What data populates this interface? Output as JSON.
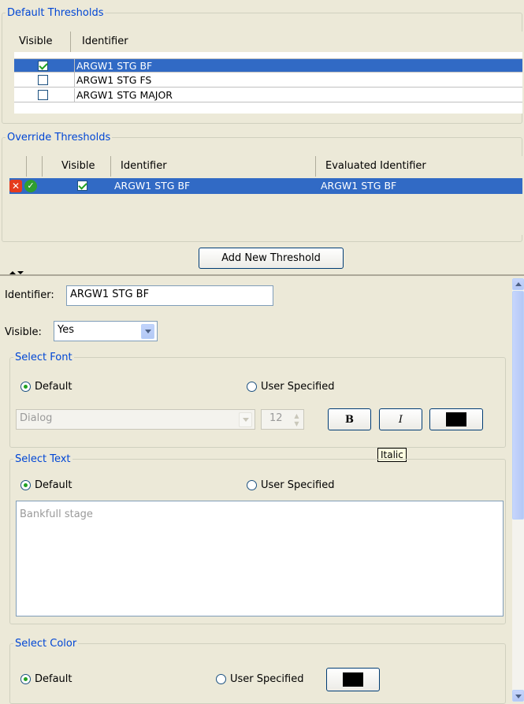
{
  "default_thresholds": {
    "title": "Default Thresholds",
    "columns": [
      "Visible",
      "Identifier"
    ],
    "rows": [
      {
        "visible": true,
        "identifier": "ARGW1 STG BF",
        "selected": true
      },
      {
        "visible": false,
        "identifier": "ARGW1 STG FS",
        "selected": false
      },
      {
        "visible": false,
        "identifier": "ARGW1 STG MAJOR",
        "selected": false
      }
    ]
  },
  "override_thresholds": {
    "title": "Override Thresholds",
    "columns": [
      "",
      "",
      "Visible",
      "Identifier",
      "Evaluated Identifier"
    ],
    "rows": [
      {
        "visible": true,
        "identifier": "ARGW1 STG BF",
        "evaluated_identifier": "ARGW1 STG BF",
        "selected": true,
        "icons": [
          "delete-icon",
          "valid-check-icon"
        ]
      }
    ]
  },
  "add_button": "Add New Threshold",
  "editor": {
    "identifier_label": "Identifier:",
    "identifier_value": "ARGW1 STG BF",
    "visible_label": "Visible:",
    "visible_value": "Yes",
    "font_group": {
      "title": "Select Font",
      "default_label": "Default",
      "user_label": "User Specified",
      "font_name": "Dialog",
      "font_size": "12",
      "bold_label": "B",
      "italic_label": "I",
      "color": "#000000"
    },
    "tooltip": "Italic",
    "text_group": {
      "title": "Select Text",
      "default_label": "Default",
      "user_label": "User Specified",
      "text_value": "Bankfull stage"
    },
    "color_group": {
      "title": "Select Color",
      "default_label": "Default",
      "user_label": "User Specified",
      "color": "#000000"
    }
  },
  "colors": {
    "selection": "#316ac5",
    "legend": "#0046d5",
    "background": "#ece9d8"
  }
}
